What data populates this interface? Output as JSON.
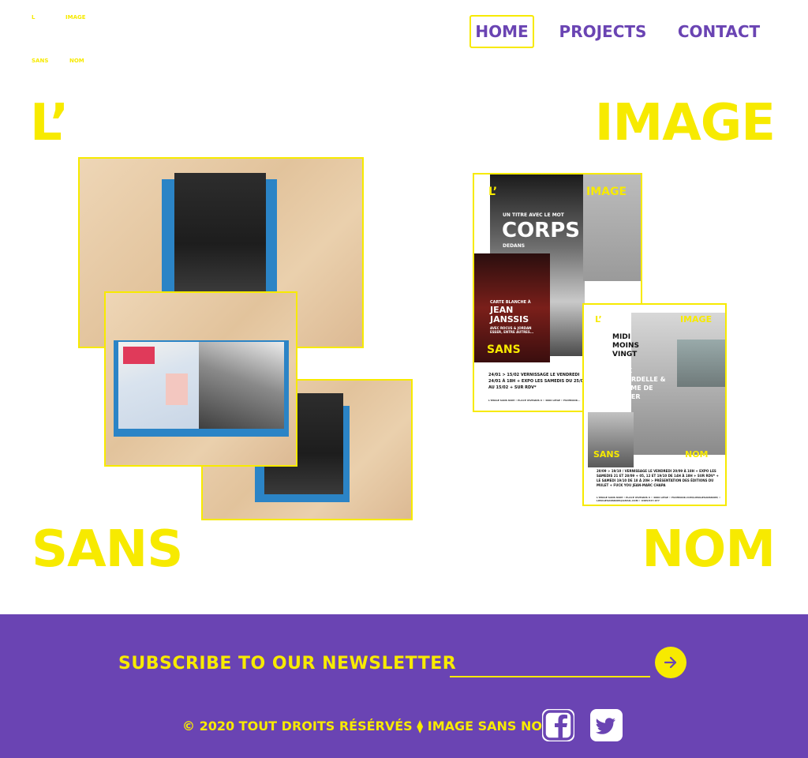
{
  "logo": {
    "l": "L",
    "image": "IMAGE",
    "sans": "SANS",
    "nom": "NOM"
  },
  "nav": {
    "items": [
      {
        "label": "HOME",
        "active": true
      },
      {
        "label": "PROJECTS",
        "active": false
      },
      {
        "label": "CONTACT",
        "active": false
      }
    ]
  },
  "hero": {
    "word1": "L’",
    "word2": "IMAGE",
    "word3": "SANS",
    "word4": "NOM"
  },
  "poster1": {
    "l": "L’",
    "image": "IMAGE",
    "line1": "UN TITRE AVEC LE MOT",
    "title": "CORPS",
    "line2": "DEDANS",
    "small": "CARTE BLANCHE À",
    "artist": "JEAN JANSSIS",
    "guests": "AVEC ROCUS & JORDAN ESSER, ENTRE AUTRES...",
    "sans": "SANS",
    "info": "24/01 > 15/02 VERNISSAGE LE VENDREDI 24/01 À 18H + EXPO LES SAMEDIS DU 25/01 AU 15/02 + SUR RDV*",
    "address": "L'IMAGE SANS NOM • PLACE VIVEGNIS 6 • 4000 LIÈGE • FACEBOOK..."
  },
  "poster2": {
    "l": "L’",
    "image": "IMAGE",
    "title": "MIDI MOINS VINGT",
    "artists": "FÉLIX COLARDELLE & MAXIME DE COSTER",
    "sans": "SANS",
    "nom": "NOM",
    "info": "20/09 > 19/10 / VERNISSAGE LE VENDREDI 20/09 À 18H + EXPO LES SAMEDIS 21 ET 28/09 + 05, 12 ET 19/10 DE 14H À 18H + SUR RDV* + LE SAMEDI 19/10 DE 18 À 20H > PRÉSENTATION DES ÉDITIONS DU MULET + FUCK YOU JEAN-MARC CHAPA",
    "address": "L'IMAGE SANS NOM • PLACE VIVEGNIS 6 • 4000 LIÈGE • FACEBOOK.COM/LIMAGESANSNOM/ • LIMAGESANSNOM@GMAIL.COM • 0485/547.977"
  },
  "footer": {
    "newsletter_label": "SUBSCRIBE TO OUR NEWSLETTER",
    "newsletter_value": "",
    "copyright": "© 2020 TOUT DROITS RÉSÉRVÉS ⧫ IMAGE SANS NOM"
  },
  "colors": {
    "yellow": "#f7ea00",
    "purple": "#6a44b3",
    "tape_blue": "#2b84c6"
  },
  "icons": {
    "submit": "arrow-right-icon",
    "facebook": "facebook-icon",
    "twitter": "twitter-icon"
  }
}
